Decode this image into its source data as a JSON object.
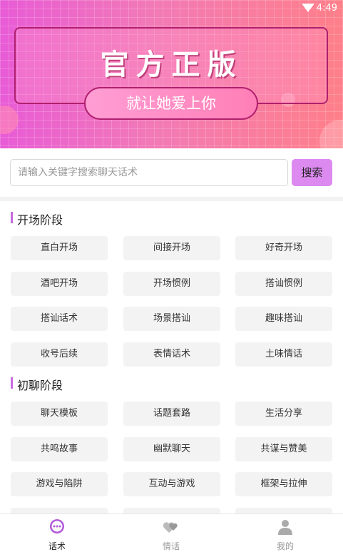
{
  "status": {
    "time": "4:49"
  },
  "banner": {
    "title": "官方正版",
    "subtitle": "就让她爱上你"
  },
  "search": {
    "placeholder": "请输入关键字搜索聊天话术",
    "button": "搜索"
  },
  "sections": [
    {
      "title": "开场阶段",
      "chips": [
        "直白开场",
        "间接开场",
        "好奇开场",
        "酒吧开场",
        "开场惯例",
        "搭讪惯例",
        "搭讪话术",
        "场景搭讪",
        "趣味搭讪",
        "收号后续",
        "表情话术",
        "土味情话"
      ]
    },
    {
      "title": "初聊阶段",
      "chips": [
        "聊天模板",
        "话题套路",
        "生活分享",
        "共鸣故事",
        "幽默聊天",
        "共谋与赞美",
        "游戏与陷阱",
        "互动与游戏",
        "框架与拉伸"
      ]
    }
  ],
  "nav": [
    {
      "label": "话术",
      "icon": "chat-bubble-icon",
      "active": true
    },
    {
      "label": "情话",
      "icon": "hearts-icon",
      "active": false
    },
    {
      "label": "我的",
      "icon": "user-icon",
      "active": false
    }
  ],
  "colors": {
    "accent": "#dc8af0",
    "section_bar": "#c86ae0",
    "active_nav": "#b05ad8",
    "inactive_nav": "#999999"
  }
}
